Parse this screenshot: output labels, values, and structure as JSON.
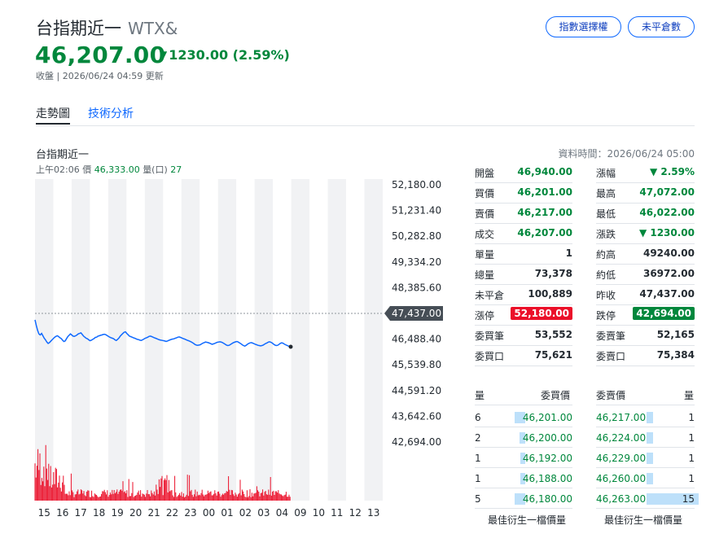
{
  "header": {
    "name": "台指期近一",
    "symbol": "WTX&",
    "price": "46,207.00",
    "change": "1230.00 (2.59%)",
    "status": "收盤 | 2026/06/24 04:59 更新",
    "buttons": [
      "指數選擇權",
      "未平倉數"
    ]
  },
  "tabs": [
    "走勢圖",
    "技術分析"
  ],
  "chart_info": {
    "name": "台指期近一",
    "time": "上午02:06",
    "price_label": "價",
    "price": "46,333.00",
    "vol_label": "量(口)",
    "vol": "27",
    "data_time": "資料時間：2026/06/24 05:00"
  },
  "chart_data": {
    "type": "line",
    "y_ticks": [
      "52,180.00",
      "51,231.40",
      "50,282.80",
      "49,334.20",
      "48,385.60",
      "47,437.00",
      "46,488.40",
      "45,539.80",
      "44,591.20",
      "43,642.60",
      "42,694.00"
    ],
    "ylim": [
      42694,
      52180
    ],
    "reference": "47,437.00",
    "x_ticks": [
      "15",
      "16",
      "17",
      "18",
      "19",
      "20",
      "21",
      "22",
      "23",
      "00",
      "01",
      "02",
      "03",
      "04",
      "09",
      "10",
      "11",
      "12",
      "13"
    ],
    "last_price": 46207,
    "price_path": [
      47200,
      46990,
      46810,
      46680,
      46640,
      46700,
      46610,
      46520,
      46460,
      46380,
      46330,
      46360,
      46410,
      46460,
      46510,
      46560,
      46590,
      46610,
      46580,
      46540,
      46510,
      46450,
      46400,
      46420,
      46500,
      46580,
      46630,
      46680,
      46640,
      46600,
      46590,
      46610,
      46640,
      46680,
      46700,
      46720,
      46660,
      46600,
      46560,
      46520,
      46500,
      46460,
      46430,
      46450,
      46480,
      46510,
      46550,
      46560,
      46600,
      46610,
      46630,
      46640,
      46660,
      46670,
      46650,
      46620,
      46590,
      46560,
      46540,
      46520,
      46500,
      46460,
      46440,
      46480,
      46530,
      46600,
      46650,
      46700,
      46740,
      46760,
      46700,
      46650,
      46600,
      46580,
      46560,
      46540,
      46520,
      46500,
      46480,
      46470,
      46450,
      46440,
      46460,
      46490,
      46520,
      46540,
      46560,
      46590,
      46600,
      46580,
      46560,
      46540,
      46520,
      46500,
      46480,
      46460,
      46450,
      46440,
      46430,
      46420,
      46400,
      46420,
      46440,
      46460,
      46480,
      46490,
      46500,
      46520,
      46540,
      46560,
      46570,
      46550,
      46530,
      46510,
      46490,
      46470,
      46450,
      46430,
      46410,
      46390,
      46360,
      46330,
      46290,
      46270,
      46260,
      46270,
      46280,
      46310,
      46340,
      46360,
      46380,
      46370,
      46360,
      46340,
      46320,
      46300,
      46310,
      46330,
      46350,
      46370,
      46380,
      46390,
      46380,
      46360,
      46330,
      46300,
      46270,
      46250,
      46260,
      46290,
      46320,
      46350,
      46370,
      46390,
      46400,
      46380,
      46350,
      46320,
      46280,
      46250,
      46230,
      46260,
      46300,
      46330,
      46350,
      46360,
      46340,
      46320,
      46300,
      46280,
      46260,
      46250,
      46240,
      46250,
      46270,
      46300,
      46330,
      46350,
      46380,
      46390,
      46370,
      46340,
      46300,
      46270,
      46250,
      46260,
      46290,
      46330,
      46350,
      46340,
      46310,
      46280,
      46260,
      46240,
      46220,
      46207
    ]
  },
  "quote_left": [
    {
      "k": "開盤",
      "v": "46,940.00",
      "c": "green"
    },
    {
      "k": "買價",
      "v": "46,201.00",
      "c": "green"
    },
    {
      "k": "賣價",
      "v": "46,217.00",
      "c": "green"
    },
    {
      "k": "成交",
      "v": "46,207.00",
      "c": "green"
    },
    {
      "k": "單量",
      "v": "1",
      "c": "black"
    },
    {
      "k": "總量",
      "v": "73,378",
      "c": "black"
    },
    {
      "k": "未平倉",
      "v": "100,889",
      "c": "black"
    },
    {
      "k": "漲停",
      "v": "52,180.00",
      "c": "red-badge"
    },
    {
      "k": "委買筆",
      "v": "53,552",
      "c": "black"
    },
    {
      "k": "委買口",
      "v": "75,621",
      "c": "black"
    }
  ],
  "quote_right": [
    {
      "k": "漲幅",
      "v": "▼ 2.59%",
      "c": "green"
    },
    {
      "k": "最高",
      "v": "47,072.00",
      "c": "green"
    },
    {
      "k": "最低",
      "v": "46,022.00",
      "c": "green"
    },
    {
      "k": "漲跌",
      "v": "▼ 1230.00",
      "c": "green"
    },
    {
      "k": "約高",
      "v": "49240.00",
      "c": "black"
    },
    {
      "k": "約低",
      "v": "36972.00",
      "c": "black"
    },
    {
      "k": "昨收",
      "v": "47,437.00",
      "c": "black"
    },
    {
      "k": "跌停",
      "v": "42,694.00",
      "c": "green-badge"
    },
    {
      "k": "委賣筆",
      "v": "52,165",
      "c": "black"
    },
    {
      "k": "委賣口",
      "v": "75,384",
      "c": "black"
    }
  ],
  "orderbook": {
    "bid_header": [
      "量",
      "委買價"
    ],
    "ask_header": [
      "委賣價",
      "量"
    ],
    "bids": [
      {
        "qty": "6",
        "price": "46,201.00",
        "bar": 0.33
      },
      {
        "qty": "2",
        "price": "46,200.00",
        "bar": 0.11
      },
      {
        "qty": "1",
        "price": "46,192.00",
        "bar": 0.06
      },
      {
        "qty": "1",
        "price": "46,188.00",
        "bar": 0.06
      },
      {
        "qty": "5",
        "price": "46,180.00",
        "bar": 0.33
      }
    ],
    "asks": [
      {
        "price": "46,217.00",
        "qty": "1",
        "bar": 0.06
      },
      {
        "price": "46,224.00",
        "qty": "1",
        "bar": 0.06
      },
      {
        "price": "46,229.00",
        "qty": "1",
        "bar": 0.06
      },
      {
        "price": "46,260.00",
        "qty": "1",
        "bar": 0.06
      },
      {
        "price": "46,263.00",
        "qty": "15",
        "bar": 1.0
      }
    ],
    "footer_bid": "最佳衍生一檔價量",
    "footer_ask": "最佳衍生一檔價量"
  },
  "colors": {
    "green": "#00873c",
    "red": "#eb0f29",
    "blue": "#0f69ff",
    "line": "#0f69ff"
  }
}
